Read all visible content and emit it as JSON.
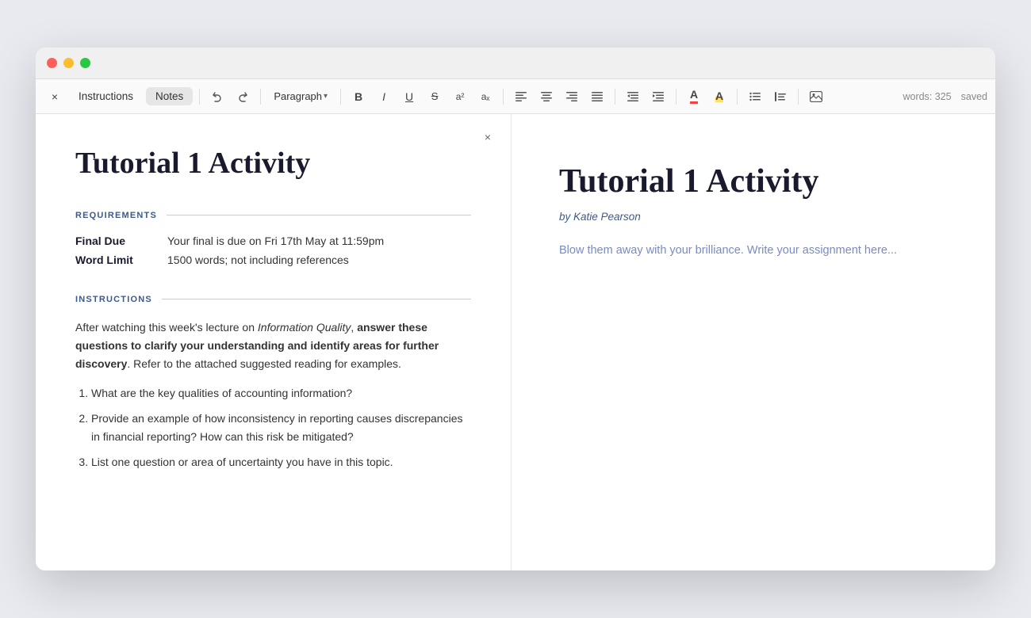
{
  "window": {
    "title": "Tutorial 1 Activity"
  },
  "titlebar": {
    "close": "×",
    "minimize": "−",
    "maximize": "+"
  },
  "toolbar": {
    "close_label": "×",
    "tabs": [
      {
        "id": "instructions",
        "label": "Instructions",
        "active": false
      },
      {
        "id": "notes",
        "label": "Notes",
        "active": true
      }
    ],
    "undo_title": "Undo",
    "redo_title": "Redo",
    "paragraph_label": "Paragraph",
    "bold_label": "B",
    "italic_label": "I",
    "underline_label": "U",
    "strikethrough_label": "S",
    "superscript_label": "a²",
    "subscript_label": "aₓ",
    "align_left": "≡",
    "align_center": "≡",
    "align_right": "≡",
    "align_justify": "≡",
    "indent_label": "⇥",
    "outdent_label": "⇤",
    "highlight_label": "A",
    "font_color_label": "A",
    "list_label": "≡",
    "blockquote_label": "\"",
    "image_label": "📷",
    "words_label": "words:",
    "words_count": "325",
    "saved_label": "saved"
  },
  "instructions_panel": {
    "close_btn": "×",
    "title": "Tutorial 1 Activity",
    "requirements_section": "REQUIREMENTS",
    "requirements": [
      {
        "label": "Final Due",
        "value": "Your final is due on Fri 17th May at 11:59pm"
      },
      {
        "label": "Word Limit",
        "value": "1500 words; not including references"
      }
    ],
    "instructions_section": "INSTRUCTIONS",
    "intro_text_1": "After watching this week's lecture on ",
    "intro_italic": "Information Quality",
    "intro_text_2": ", ",
    "intro_bold": "answer these questions to clarify your understanding and identify areas for further discovery",
    "intro_text_3": ". Refer to the attached suggested reading for examples.",
    "questions": [
      "What are the key qualities of accounting information?",
      "Provide an example of how inconsistency in reporting causes discrepancies in financial reporting? How can this risk be mitigated?",
      "List one question or area of uncertainty you have in this topic."
    ]
  },
  "notes_panel": {
    "title": "Tutorial 1 Activity",
    "author": "by Katie Pearson",
    "placeholder": "Blow them away with your brilliance. Write your assignment here..."
  }
}
